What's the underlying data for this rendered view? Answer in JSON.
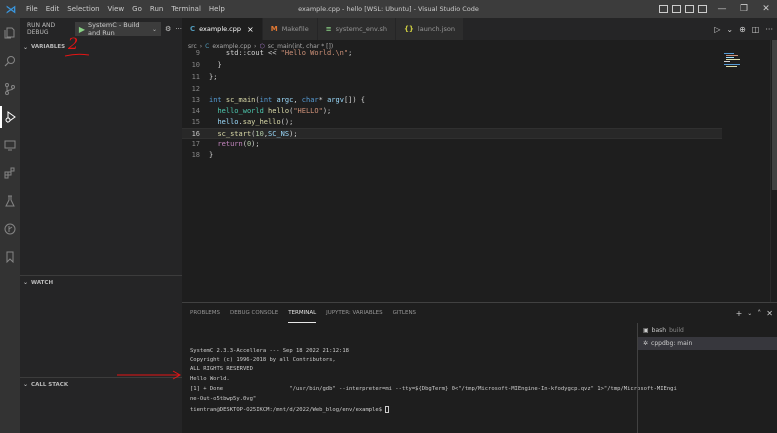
{
  "window": {
    "title": "example.cpp - hello [WSL: Ubuntu] - Visual Studio Code",
    "menu": [
      "File",
      "Edit",
      "Selection",
      "View",
      "Go",
      "Run",
      "Terminal",
      "Help"
    ]
  },
  "sidebar": {
    "header": "RUN AND DEBUG",
    "config_name": "SystemC - Build and Run",
    "sections": {
      "variables": "VARIABLES",
      "watch": "WATCH",
      "callstack": "CALL STACK"
    },
    "annotation": "2"
  },
  "tabs": [
    {
      "icon": "C",
      "label": "example.cpp",
      "active": true,
      "close": "×"
    },
    {
      "icon": "M",
      "label": "Makefile",
      "active": false
    },
    {
      "icon": "≡",
      "label": "systemc_env.sh",
      "active": false
    },
    {
      "icon": "{}",
      "label": "launch.json",
      "active": false
    }
  ],
  "breadcrumb": {
    "folder": "src",
    "file": "example.cpp",
    "symbol": "sc_main(int, char * [])"
  },
  "code": {
    "lines": [
      {
        "n": "9",
        "text": "std::cout << \"Hello World.\\n\";"
      },
      {
        "n": "10",
        "text": "}"
      },
      {
        "n": "11",
        "text": "};"
      },
      {
        "n": "12",
        "text": ""
      },
      {
        "n": "13",
        "text": "int sc_main(int argc, char* argv[]) {"
      },
      {
        "n": "14",
        "text": "hello_world hello(\"HELLO\");"
      },
      {
        "n": "15",
        "text": "hello.say_hello();"
      },
      {
        "n": "16",
        "text": "sc_start(10,SC_NS);"
      },
      {
        "n": "17",
        "text": "return(0);"
      },
      {
        "n": "18",
        "text": "}"
      }
    ]
  },
  "panel": {
    "tabs": [
      "PROBLEMS",
      "DEBUG CONSOLE",
      "TERMINAL",
      "JUPYTER: VARIABLES",
      "GITLENS"
    ],
    "active_tab": "TERMINAL",
    "terminal_lines": [
      "SystemC 2.3.3-Accellera --- Sep 18 2022 21:12:18",
      "Copyright (c) 1996-2018 by all Contributors,",
      "ALL RIGHTS RESERVED",
      "Hello World.",
      "[1] + Done                    \"/usr/bin/gdb\" --interpreter=mi --tty=${DbgTerm} 0<\"/tmp/Microsoft-MIEngine-In-kfodygcp.qvz\" 1>\"/tmp/Microsoft-MIEngi",
      "ne-Out-o5tbwp5y.0vg\"",
      "tientran@DESKTOP-O25IKCM:/mnt/d/2022/Web_blog/env/example$ "
    ],
    "terminals": [
      {
        "name": "bash",
        "sub": "build",
        "selected": false
      },
      {
        "name": "cppdbg: main",
        "sub": "",
        "selected": true
      }
    ]
  },
  "colors": {
    "accent": "#007acc",
    "annotation": "#e51414",
    "keyword": "#569cd6",
    "function": "#dcdcaa",
    "string": "#ce9178"
  }
}
